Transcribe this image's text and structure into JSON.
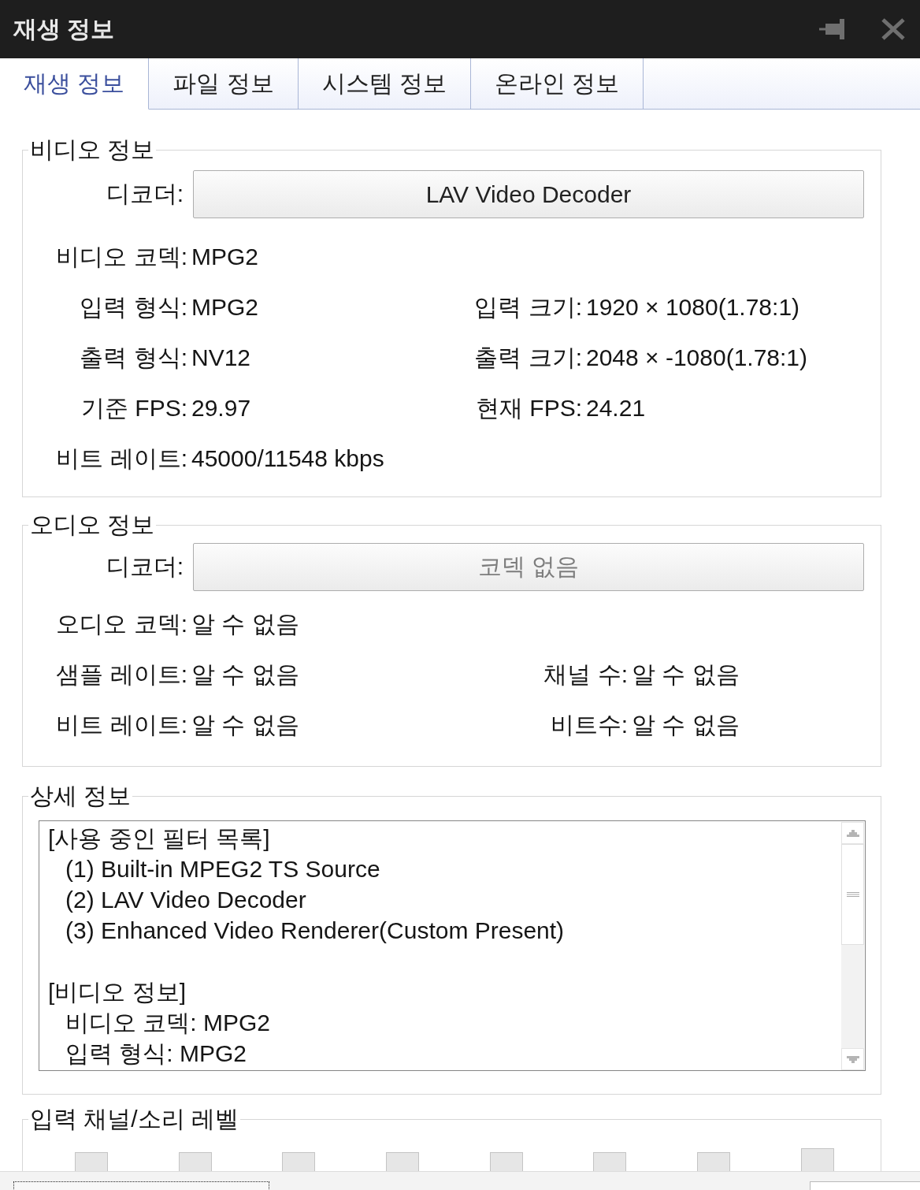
{
  "window": {
    "title": "재생 정보"
  },
  "tabs": [
    {
      "label": "재생 정보",
      "selected": true
    },
    {
      "label": "파일 정보",
      "selected": false
    },
    {
      "label": "시스템 정보",
      "selected": false
    },
    {
      "label": "온라인 정보",
      "selected": false
    }
  ],
  "video": {
    "title": "비디오 정보",
    "decoder": {
      "label": "디코더:",
      "value": "LAV Video Decoder",
      "disabled": false
    },
    "rows": [
      [
        {
          "label": "비디오 코덱:",
          "value": "MPG2"
        }
      ],
      [
        {
          "label": "입력 형식:",
          "value": "MPG2"
        },
        {
          "label": "입력 크기:",
          "value": "1920 × 1080(1.78:1)"
        }
      ],
      [
        {
          "label": "출력 형식:",
          "value": "NV12"
        },
        {
          "label": "출력 크기:",
          "value": "2048 × -1080(1.78:1)"
        }
      ],
      [
        {
          "label": "기준 FPS:",
          "value": "29.97"
        },
        {
          "label": "현재 FPS:",
          "value": "24.21"
        }
      ],
      [
        {
          "label": "비트 레이트:",
          "value": "45000/11548 kbps"
        }
      ]
    ]
  },
  "audio": {
    "title": "오디오 정보",
    "decoder": {
      "label": "디코더:",
      "value": "코덱 없음",
      "disabled": true
    },
    "rows": [
      [
        {
          "label": "오디오 코덱:",
          "value": "알 수 없음"
        }
      ],
      [
        {
          "label": "샘플 레이트:",
          "value": "알 수 없음"
        },
        {
          "label": "채널 수:",
          "value": "알 수 없음"
        }
      ],
      [
        {
          "label": "비트 레이트:",
          "value": "알 수 없음"
        },
        {
          "label": "비트수:",
          "value": "알 수 없음"
        }
      ]
    ]
  },
  "details": {
    "title": "상세 정보",
    "sections": [
      {
        "heading": "[사용 중인 필터 목록]",
        "children": [
          {
            "text": "(1) Built-in MPEG2 TS Source"
          },
          {
            "text": "(2) LAV Video Decoder"
          },
          {
            "text": "(3) Enhanced Video Renderer(Custom Present)"
          }
        ]
      },
      {
        "heading": "[비디오 정보]",
        "children": [
          {
            "text": "비디오 코덱: MPG2"
          },
          {
            "text": "입력 형식: MPG2"
          }
        ]
      }
    ]
  },
  "levels": {
    "title": "입력 채널/소리 레벨"
  }
}
